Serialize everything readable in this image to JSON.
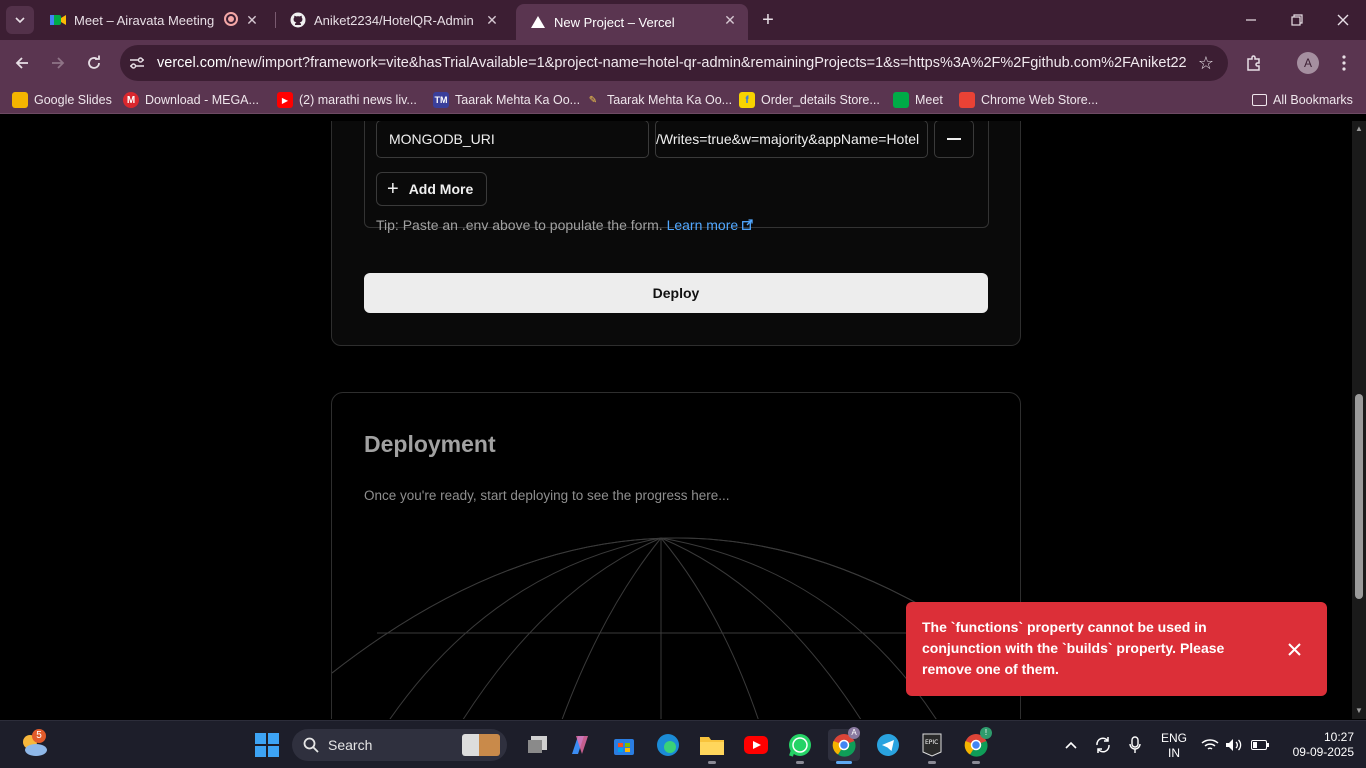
{
  "browser": {
    "tabs": [
      {
        "title": "Meet – Airavata Meeting",
        "icon": "google-meet-icon"
      },
      {
        "title": "Aniket2234/HotelQR-Admin",
        "icon": "github-icon"
      },
      {
        "title": "New Project – Vercel",
        "icon": "vercel-icon"
      }
    ],
    "url_host": "vercel.com",
    "url_rest": "/new/import?framework=vite&hasTrialAvailable=1&project-name=hotel-qr-admin&remainingProjects=1&s=https%3A%2F%2Fgithub.com%2FAniket223...",
    "profile_initial": "A",
    "bookmarks": [
      "Google Slides",
      "Download - MEGA...",
      "(2) marathi news liv...",
      "Taarak Mehta Ka Oo...",
      "Taarak Mehta Ka Oo...",
      "Order_details Store...",
      "Meet",
      "Chrome Web Store..."
    ],
    "all_bookmarks": "All Bookmarks"
  },
  "env": {
    "key": "MONGODB_URI",
    "value": "/Writes=true&w=majority&appName=Hotel",
    "add_more": "Add More",
    "tip": "Tip: Paste an .env above to populate the form.",
    "learn_more": "Learn more"
  },
  "deploy_label": "Deploy",
  "deployment": {
    "title": "Deployment",
    "subtitle": "Once you're ready, start deploying to see the progress here..."
  },
  "toast": {
    "message": "The `functions` property cannot be used in conjunction with the `builds` property. Please remove one of them."
  },
  "taskbar": {
    "weather_badge": "5",
    "search_label": "Search",
    "chrome_badge": "A",
    "chrome2_badge": "!",
    "lang_top": "ENG",
    "lang_bottom": "IN",
    "time": "10:27",
    "date": "09-09-2025"
  },
  "colors": {
    "chrome_frame": "#3c1e33",
    "chrome_toolbar": "#5a3550",
    "toast_red": "#dc2f38",
    "link_blue": "#52a8ff"
  }
}
